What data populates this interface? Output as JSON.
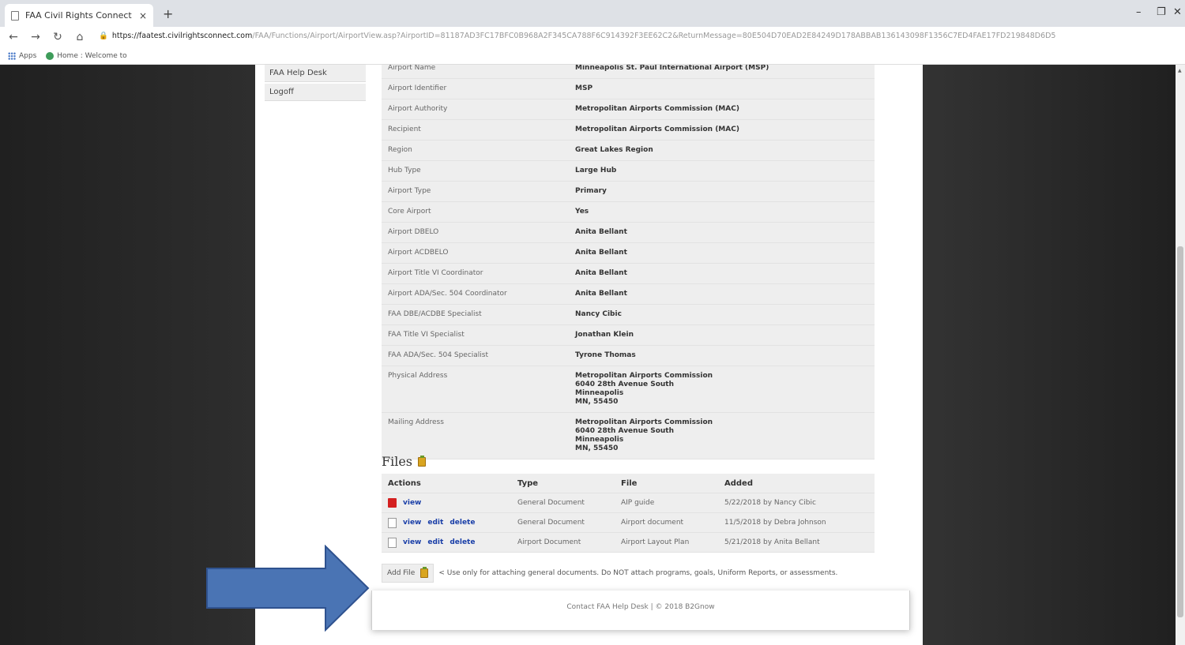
{
  "browser": {
    "tab_title": "FAA Civil Rights Connect",
    "tab_close": "×",
    "new_tab": "+",
    "url_host": "https://faatest.civilrightsconnect.com",
    "url_path": "/FAA/Functions/Airport/AirportView.asp?AirportID=81187AD3FC17BFC0B968A2F345CA788F6C914392F3EE62C2&ReturnMessage=80E504D70EAD2E84249D178ABBAB136143098F1356C7ED4FAE17FD219848D6D5",
    "bookmarks": [
      {
        "label": "Apps"
      },
      {
        "label": "Home : Welcome to"
      }
    ]
  },
  "nav": {
    "items": [
      {
        "label": "FAA Help Desk"
      },
      {
        "label": "Logoff"
      }
    ]
  },
  "airport_info": {
    "rows": [
      {
        "label": "Airport Name",
        "value": "Minneapolis St. Paul International Airport (MSP)"
      },
      {
        "label": "Airport Identifier",
        "value": "MSP"
      },
      {
        "label": "Airport Authority",
        "value": "Metropolitan Airports Commission (MAC)"
      },
      {
        "label": "Recipient",
        "value": "Metropolitan Airports Commission (MAC)"
      },
      {
        "label": "Region",
        "value": "Great Lakes Region"
      },
      {
        "label": "Hub Type",
        "value": "Large Hub"
      },
      {
        "label": "Airport Type",
        "value": "Primary"
      },
      {
        "label": "Core Airport",
        "value": "Yes"
      },
      {
        "label": "Airport DBELO",
        "value": "Anita Bellant"
      },
      {
        "label": "Airport ACDBELO",
        "value": "Anita Bellant"
      },
      {
        "label": "Airport Title VI Coordinator",
        "value": "Anita Bellant"
      },
      {
        "label": "Airport ADA/Sec. 504 Coordinator",
        "value": "Anita Bellant"
      },
      {
        "label": "FAA DBE/ACDBE Specialist",
        "value": "Nancy Cibic"
      },
      {
        "label": "FAA Title VI Specialist",
        "value": "Jonathan Klein"
      },
      {
        "label": "FAA ADA/Sec. 504 Specialist",
        "value": "Tyrone Thomas"
      },
      {
        "label": "Physical Address",
        "value": "Metropolitan Airports Commission\n6040 28th Avenue South\nMinneapolis\nMN, 55450"
      },
      {
        "label": "Mailing Address",
        "value": "Metropolitan Airports Commission\n6040 28th Avenue South\nMinneapolis\nMN, 55450"
      }
    ]
  },
  "files": {
    "heading": "Files",
    "columns": {
      "actions": "Actions",
      "type": "Type",
      "file": "File",
      "added": "Added"
    },
    "rows": [
      {
        "icon": "pdf-icon",
        "view": "view",
        "edit": "",
        "delete": "",
        "type": "General Document",
        "file": "AIP guide",
        "added": "5/22/2018 by Nancy Cibic"
      },
      {
        "icon": "document-icon",
        "view": "view",
        "edit": "edit",
        "delete": "delete",
        "type": "General Document",
        "file": "Airport document",
        "added": "11/5/2018 by Debra Johnson"
      },
      {
        "icon": "document-icon",
        "view": "view",
        "edit": "edit",
        "delete": "delete",
        "type": "Airport Document",
        "file": "Airport Layout Plan",
        "added": "5/21/2018 by Anita Bellant"
      }
    ],
    "add_file_label": "Add File",
    "add_file_note": "< Use only for attaching general documents. Do NOT attach programs, goals, Uniform Reports, or assessments."
  },
  "footer": {
    "text": "Contact FAA Help Desk | © 2018 B2Gnow"
  },
  "colors": {
    "arrow": "#4a74b4",
    "arrow_border": "#2f528f",
    "link": "#1a3fa8"
  }
}
